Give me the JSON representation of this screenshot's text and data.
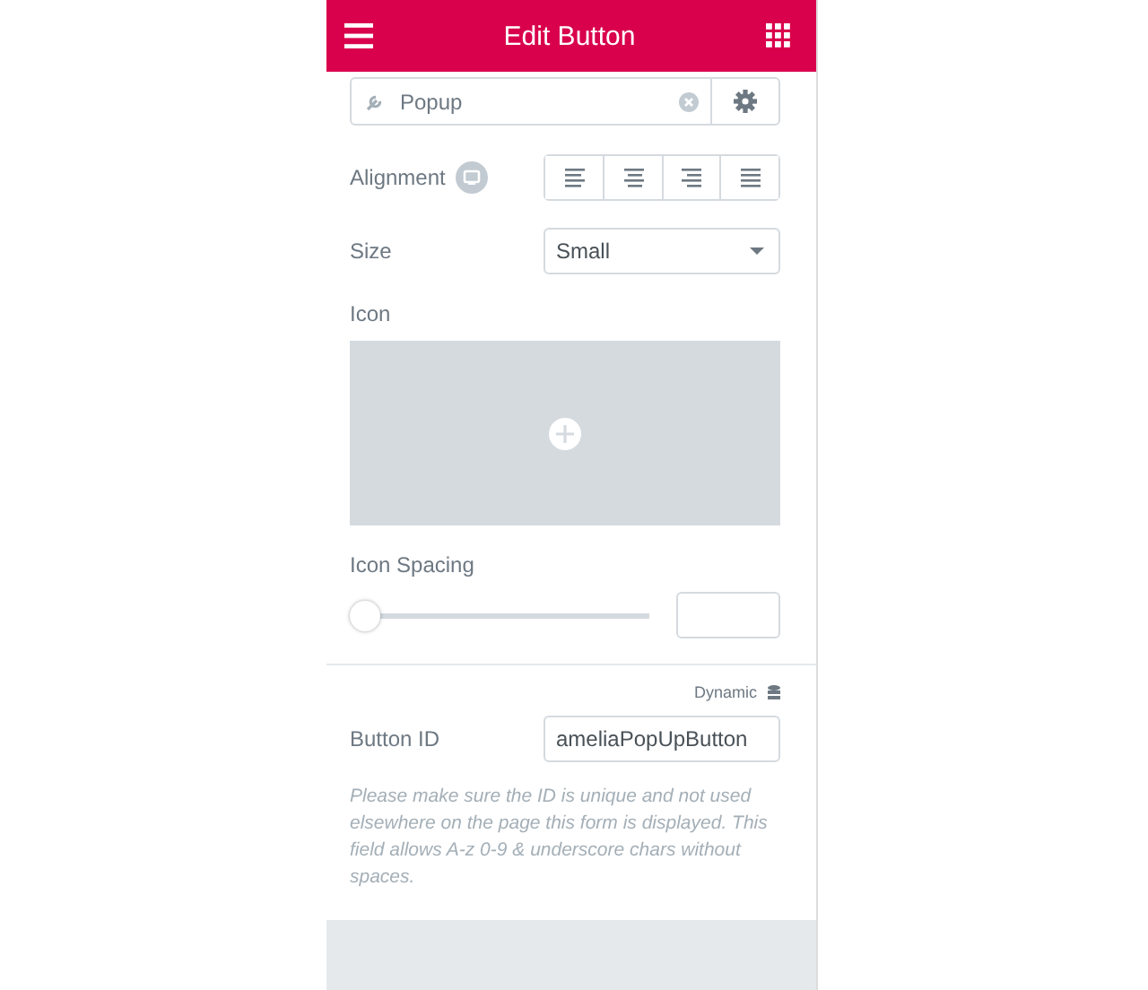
{
  "header": {
    "title": "Edit Button"
  },
  "link": {
    "value": "Popup"
  },
  "alignment": {
    "label": "Alignment",
    "options": [
      {
        "kind": "left"
      },
      {
        "kind": "center"
      },
      {
        "kind": "right"
      },
      {
        "kind": "justify"
      }
    ]
  },
  "size": {
    "label": "Size",
    "value": "Small"
  },
  "icon": {
    "label": "Icon"
  },
  "icon_spacing": {
    "label": "Icon Spacing",
    "level": 0
  },
  "dynamic": {
    "label": "Dynamic"
  },
  "button_id": {
    "label": "Button ID",
    "value": "ameliaPopUpButton",
    "note": "Please make sure the ID is unique and not used elsewhere on the page this form is displayed. This field allows A-z  0-9 & underscore chars without spaces."
  }
}
